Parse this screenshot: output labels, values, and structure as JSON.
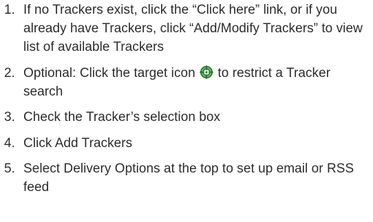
{
  "steps": [
    {
      "number": "1.",
      "text": "If no Trackers exist, click the “Click here” link, or if you already have Trackers, click “Add/Modify Trackers” to view list of available Trackers"
    },
    {
      "number": "2.",
      "text_before_icon": "Optional: Click the target icon",
      "icon": "target-icon",
      "text_after_icon": "to restrict a Tracker search"
    },
    {
      "number": "3.",
      "text": "Check the Tracker’s selection box"
    },
    {
      "number": "4.",
      "text": "Click Add Trackers"
    },
    {
      "number": "5.",
      "text": "Select Delivery Options at the top to set up email or RSS feed"
    }
  ],
  "colors": {
    "text": "#2b2b2b",
    "icon_fill": "#4caf50",
    "icon_stroke": "#1e6b2a"
  }
}
